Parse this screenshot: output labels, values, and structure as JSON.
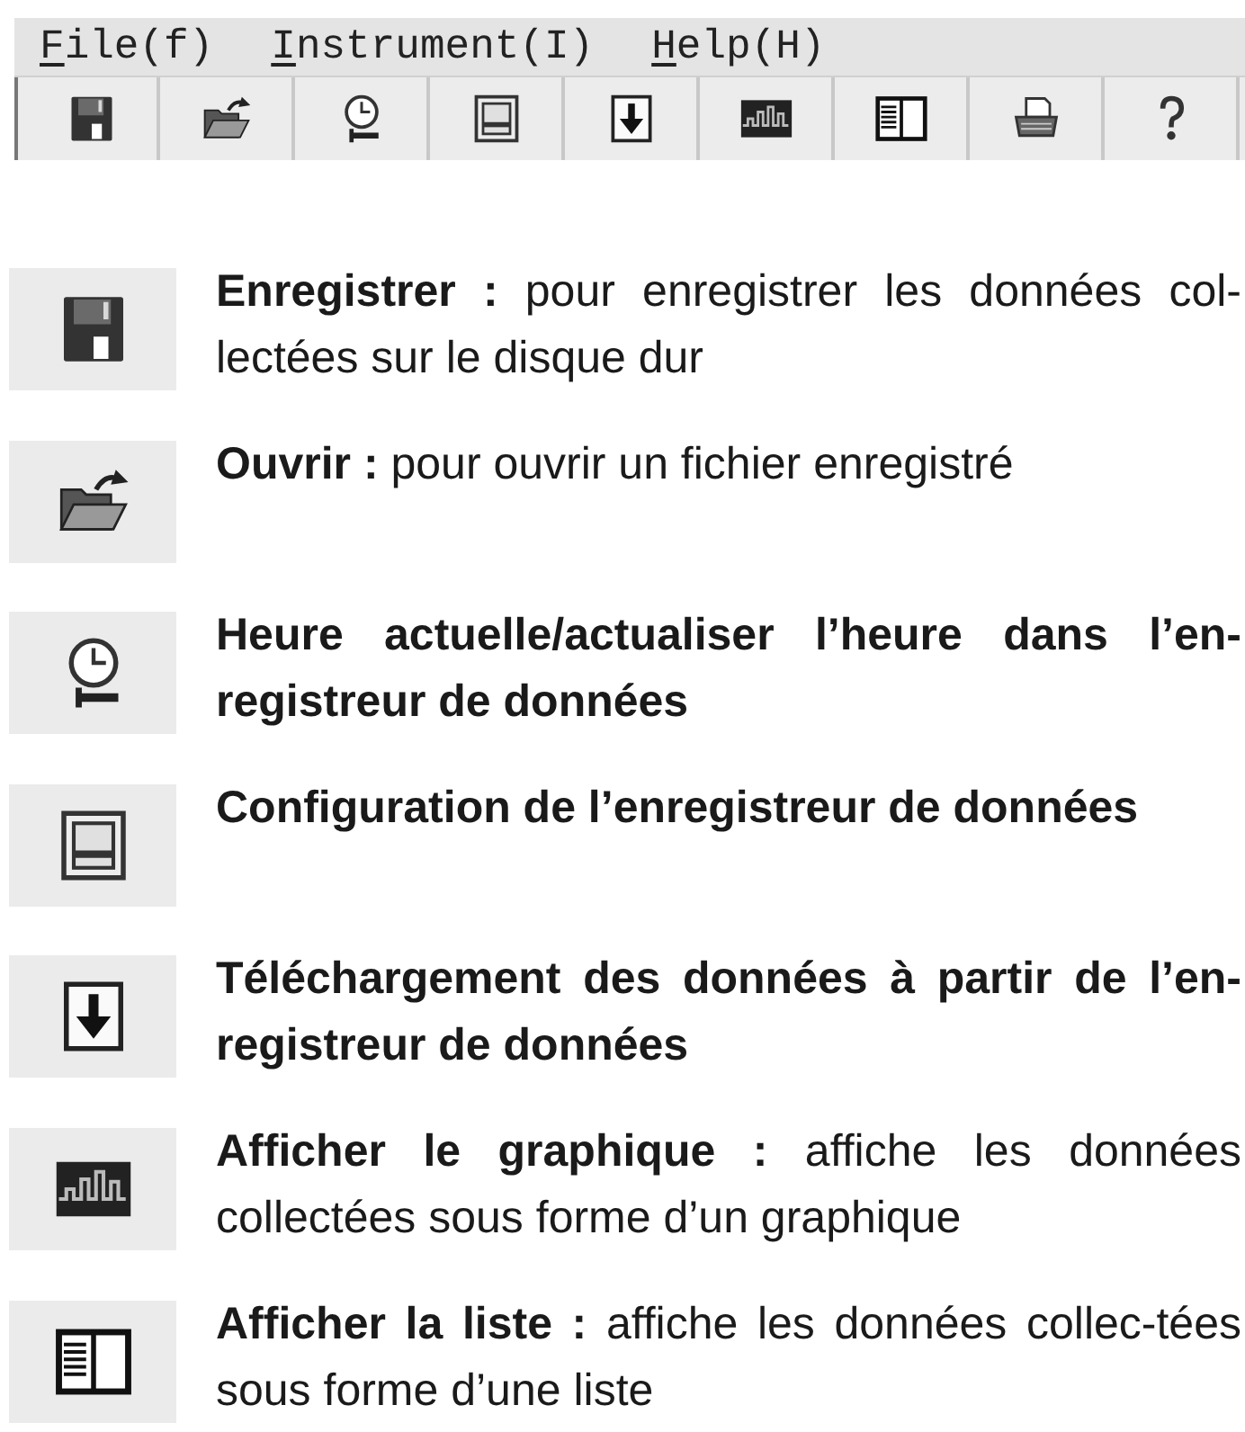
{
  "menu_bar": [
    {
      "label": "File(f)"
    },
    {
      "label": "Instrument(I)"
    },
    {
      "label": "Help(H)"
    }
  ],
  "toolbar": [
    {
      "kind": "save"
    },
    {
      "kind": "open"
    },
    {
      "kind": "clock"
    },
    {
      "kind": "window"
    },
    {
      "kind": "download"
    },
    {
      "kind": "graph"
    },
    {
      "kind": "list"
    },
    {
      "kind": "print"
    },
    {
      "kind": "help"
    }
  ],
  "descriptions": [
    {
      "kind": "save",
      "bold": false,
      "text": "**Enregistrer :** pour enregistrer les données col-lectées sur le disque dur"
    },
    {
      "kind": "open",
      "bold": false,
      "text": "**Ouvrir :** pour ouvrir un fichier enregistré"
    },
    {
      "kind": "clock",
      "bold": true,
      "text": "Heure actuelle/actualiser l’heure dans l’en-registreur de données"
    },
    {
      "kind": "window",
      "bold": true,
      "text": "Configuration de l’enregistreur de données"
    },
    {
      "kind": "download",
      "bold": true,
      "text": "Téléchargement des données à partir de l’en-registreur de données"
    },
    {
      "kind": "graph",
      "bold": false,
      "text": "**Afficher le graphique :** affiche les données collectées sous forme d’un graphique"
    },
    {
      "kind": "list",
      "bold": false,
      "text": "**Afficher la liste :** affiche les données collec-tées sous forme d’une liste"
    }
  ]
}
